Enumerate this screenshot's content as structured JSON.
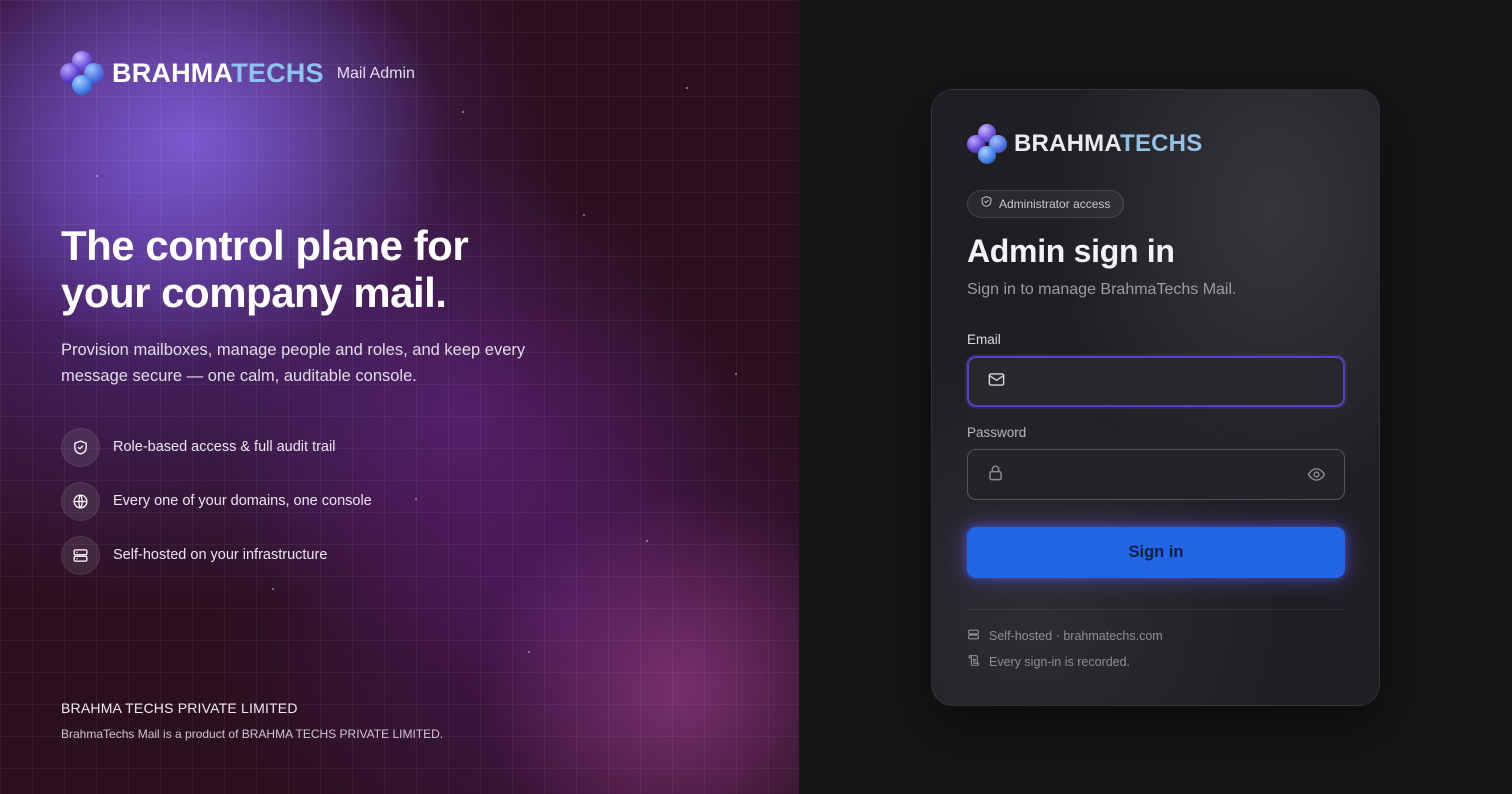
{
  "left": {
    "brand": {
      "word_part1": "BRAHMA",
      "word_part2": "TECHS",
      "subtitle": "Mail Admin"
    },
    "headline_line1": "The control plane for",
    "headline_line2": "your company mail.",
    "lead": "Provision mailboxes, manage people and roles, and keep every message secure — one calm, auditable console.",
    "features": [
      {
        "icon": "shield-check-icon",
        "label": "Role-based access & full audit trail"
      },
      {
        "icon": "globe-icon",
        "label": "Every one of your domains, one console"
      },
      {
        "icon": "server-icon",
        "label": "Self-hosted on your infrastructure"
      }
    ],
    "company": "BRAHMA TECHS PRIVATE LIMITED",
    "company_note": "BrahmaTechs Mail is a product of BRAHMA TECHS PRIVATE LIMITED."
  },
  "card": {
    "brand": {
      "word_part1": "BRAHMA",
      "word_part2": "TECHS"
    },
    "pill": {
      "icon": "shield-icon",
      "label": "Administrator access"
    },
    "title": "Admin sign in",
    "subtitle": "Sign in to manage BrahmaTechs Mail.",
    "email": {
      "label": "Email",
      "value": "",
      "icon": "mail-icon"
    },
    "password": {
      "label": "Password",
      "value": "",
      "icon": "lock-icon",
      "toggle_icon": "eye-icon"
    },
    "submit_label": "Sign in",
    "footer": [
      {
        "icon": "server-icon",
        "label": "Self-hosted · brahmatechs.com"
      },
      {
        "icon": "scroll-icon",
        "label": "Every sign-in is recorded."
      }
    ]
  },
  "colors": {
    "accent": "#2266e6",
    "focus_ring": "#5b3fc4",
    "brand_light": "#8cc4ee",
    "left_bg": "#2a0f1c",
    "right_bg": "#161618",
    "card_bg": "#1f1f23"
  }
}
